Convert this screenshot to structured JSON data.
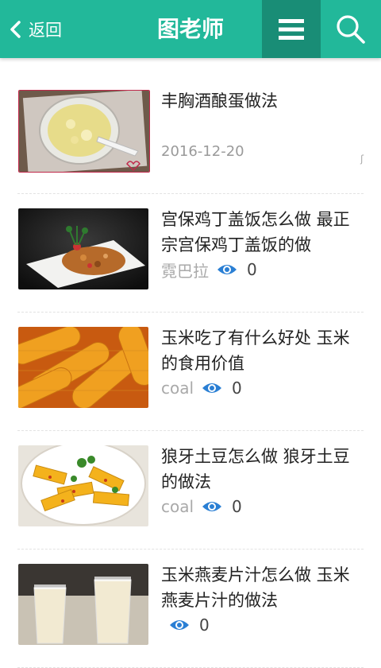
{
  "header": {
    "back_label": "返回",
    "title": "图老师"
  },
  "articles": [
    {
      "title": "丰胸酒酿蛋做法",
      "date": "2016-12-20"
    },
    {
      "title": "宫保鸡丁盖饭怎么做 最正宗宫保鸡丁盖饭的做",
      "author": "霓巴拉",
      "views": "0"
    },
    {
      "title": "玉米吃了有什么好处 玉米的食用价值",
      "author": "coal",
      "views": "0"
    },
    {
      "title": "狼牙土豆怎么做 狼牙土豆的做法",
      "author": "coal",
      "views": "0"
    },
    {
      "title": "玉米燕麦片汁怎么做 玉米燕麦片汁的做法",
      "author": "",
      "views": "0"
    }
  ],
  "colors": {
    "topbar": "#22b89a",
    "menu_button": "#198d76",
    "eye_icon": "#2a7fd4"
  }
}
